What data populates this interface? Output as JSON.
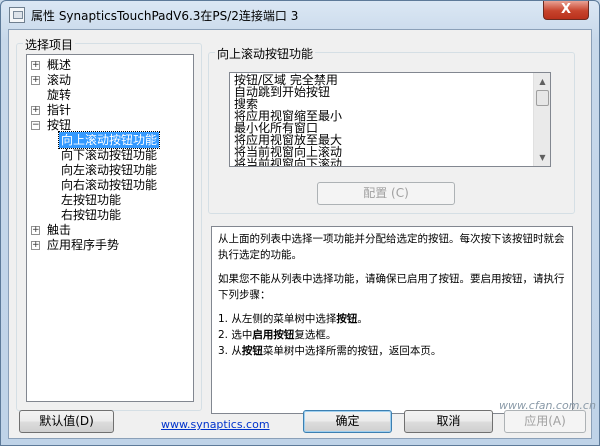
{
  "window": {
    "title": "属性 SynapticsTouchPadV6.3在PS/2连接端口 3",
    "close_glyph": "X"
  },
  "left_group": {
    "label": "选择项目",
    "tree": [
      {
        "label": "概述",
        "expander": "+"
      },
      {
        "label": "滚动",
        "expander": "+"
      },
      {
        "label": "旋转",
        "expander": ""
      },
      {
        "label": "指针",
        "expander": "+"
      },
      {
        "label": "按钮",
        "expander": "−"
      },
      {
        "label": "向上滚动按钮功能",
        "selected": true
      },
      {
        "label": "向下滚动按钮功能"
      },
      {
        "label": "向左滚动按钮功能"
      },
      {
        "label": "向右滚动按钮功能"
      },
      {
        "label": "左按钮功能"
      },
      {
        "label": "右按钮功能"
      },
      {
        "label": "触击",
        "expander": "+"
      },
      {
        "label": "应用程序手势",
        "expander": "+"
      }
    ]
  },
  "right_group": {
    "label": "向上滚动按钮功能",
    "list_items": [
      "按钮/区域 完全禁用",
      "自动跳到开始按钮",
      "搜索",
      "将应用视窗缩至最小",
      "最小化所有窗口",
      "将应用视窗放至最大",
      "将当前视窗向上滚动",
      "将当前视窗向下滚动"
    ],
    "configure_button": "配置 (C)"
  },
  "description": {
    "para1": "从上面的列表中选择一项功能并分配给选定的按钮。每次按下该按钮时就会执行选定的功能。",
    "para2": "如果您不能从列表中选择功能，请确保已启用了按钮。要启用按钮，请执行下列步骤：",
    "step1_prefix": "1. 从左侧的菜单树中选择",
    "step1_bold": "按钮",
    "step1_suffix": "。",
    "step2_prefix": "2. 选中",
    "step2_bold": "启用按钮",
    "step2_suffix": "复选框。",
    "step3_prefix": "3. 从",
    "step3_bold": "按钮",
    "step3_suffix": "菜单树中选择所需的按钮，返回本页。"
  },
  "footer": {
    "defaults_button": "默认值(D)",
    "link": "www.synaptics.com",
    "ok_button": "确定",
    "cancel_button": "取消",
    "apply_button": "应用(A)",
    "watermark": "www.cfan.com.cn"
  }
}
